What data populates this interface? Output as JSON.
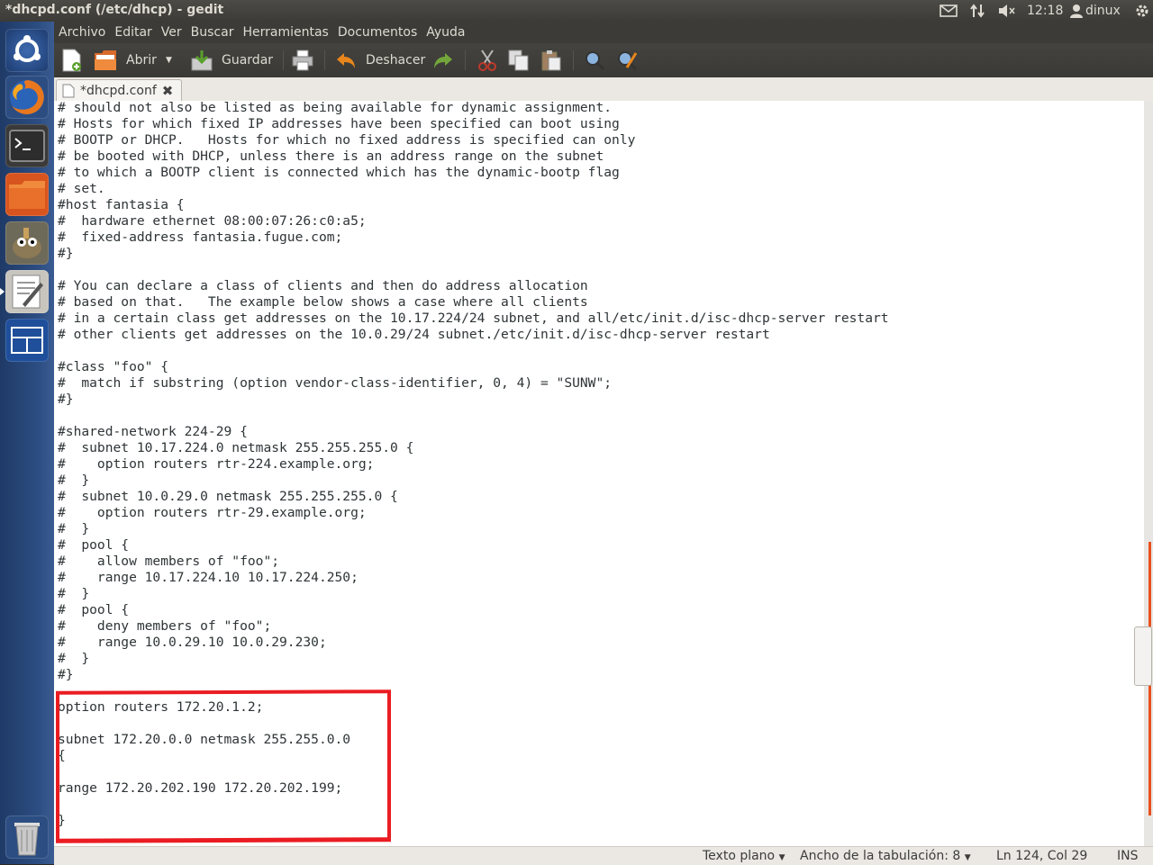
{
  "window": {
    "title": "*dhcpd.conf (/etc/dhcp) - gedit"
  },
  "tray": {
    "clock": "12:18",
    "user": "dinux"
  },
  "menubar": {
    "items": [
      "Archivo",
      "Editar",
      "Ver",
      "Buscar",
      "Herramientas",
      "Documentos",
      "Ayuda"
    ]
  },
  "toolbar": {
    "open_label": "Abrir",
    "save_label": "Guardar",
    "undo_label": "Deshacer"
  },
  "tab": {
    "label": "*dhcpd.conf"
  },
  "editor": {
    "text": "# should not also be listed as being available for dynamic assignment.\n# Hosts for which fixed IP addresses have been specified can boot using\n# BOOTP or DHCP.   Hosts for which no fixed address is specified can only\n# be booted with DHCP, unless there is an address range on the subnet\n# to which a BOOTP client is connected which has the dynamic-bootp flag\n# set.\n#host fantasia {\n#  hardware ethernet 08:00:07:26:c0:a5;\n#  fixed-address fantasia.fugue.com;\n#}\n\n# You can declare a class of clients and then do address allocation\n# based on that.   The example below shows a case where all clients\n# in a certain class get addresses on the 10.17.224/24 subnet, and all/etc/init.d/isc-dhcp-server restart\n# other clients get addresses on the 10.0.29/24 subnet./etc/init.d/isc-dhcp-server restart\n\n#class \"foo\" {\n#  match if substring (option vendor-class-identifier, 0, 4) = \"SUNW\";\n#}\n\n#shared-network 224-29 {\n#  subnet 10.17.224.0 netmask 255.255.255.0 {\n#    option routers rtr-224.example.org;\n#  }\n#  subnet 10.0.29.0 netmask 255.255.255.0 {\n#    option routers rtr-29.example.org;\n#  }\n#  pool {\n#    allow members of \"foo\";\n#    range 10.17.224.10 10.17.224.250;\n#  }\n#  pool {\n#    deny members of \"foo\";\n#    range 10.0.29.10 10.0.29.230;\n#  }\n#}\n\noption routers 172.20.1.2;\n\nsubnet 172.20.0.0 netmask 255.255.0.0\n{\n\nrange 172.20.202.190 172.20.202.199;\n\n}"
  },
  "statusbar": {
    "language": "Texto plano",
    "tab_width_label": "Ancho de la tabulación:",
    "tab_width": "8",
    "position": "Ln 124, Col 29",
    "mode": "INS"
  },
  "colors": {
    "highlight": "#ea1c22",
    "launcher": "#2c4d82",
    "panel": "#3c3b37"
  }
}
